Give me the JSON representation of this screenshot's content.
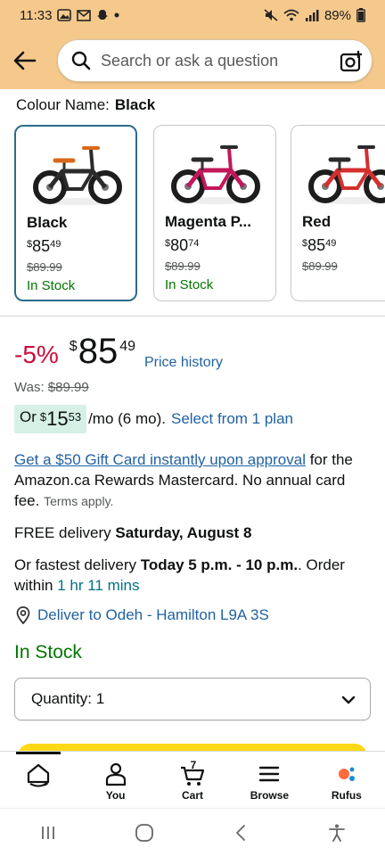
{
  "status_bar": {
    "time": "11:33",
    "battery": "89%"
  },
  "search": {
    "placeholder": "Search or ask a question"
  },
  "colour": {
    "label": "Colour Name:",
    "selected": "Black"
  },
  "variants": [
    {
      "name": "Black",
      "price_currency": "$",
      "price_whole": "85",
      "price_fraction": "49",
      "was": "$89.99",
      "stock": "In Stock",
      "frame_color": "#2b2b2b",
      "accent_color": "#d9691a"
    },
    {
      "name": "Magenta P...",
      "price_currency": "$",
      "price_whole": "80",
      "price_fraction": "74",
      "was": "$89.99",
      "stock": "In Stock",
      "frame_color": "#c2185b",
      "accent_color": "#2b2b2b"
    },
    {
      "name": "Red",
      "price_currency": "$",
      "price_whole": "85",
      "price_fraction": "49",
      "was": "$89.99",
      "stock": "",
      "frame_color": "#d32f2f",
      "accent_color": "#2b2b2b"
    }
  ],
  "price": {
    "discount": "-5%",
    "currency": "$",
    "whole": "85",
    "fraction": "49",
    "history_link": "Price history",
    "was_label": "Was:",
    "was_value": "$89.99"
  },
  "plan": {
    "prefix": "Or",
    "currency": "$",
    "whole": "15",
    "fraction": "53",
    "suffix": "/mo (6 mo).",
    "link": "Select from 1 plan"
  },
  "promo": {
    "link": "Get a $50 Gift Card instantly upon approval",
    "text": " for the Amazon.ca Rewards Mastercard. No annual card fee. ",
    "terms": "Terms apply."
  },
  "delivery": {
    "free_prefix": "FREE delivery ",
    "free_date": "Saturday, August 8",
    "fast_prefix": "Or fastest delivery ",
    "fast_window": "Today 5 p.m. - 10 p.m.",
    "order_within": ". Order within ",
    "timer": "1 hr 11 mins",
    "deliver_to": "Deliver to Odeh - Hamilton L9A 3S"
  },
  "availability": "In Stock",
  "quantity": {
    "label": "Quantity:",
    "value": "1"
  },
  "bottom_nav": [
    {
      "label": ""
    },
    {
      "label": "You"
    },
    {
      "label": "Cart",
      "badge": "7"
    },
    {
      "label": "Browse"
    },
    {
      "label": "Rufus"
    }
  ],
  "colors": {
    "header_bg": "#f5c98c",
    "link": "#2162a1",
    "deal_red": "#cc0c39",
    "stock_green": "#007600",
    "selected_border": "#2d6b8a",
    "cart_yellow": "#ffd814"
  }
}
